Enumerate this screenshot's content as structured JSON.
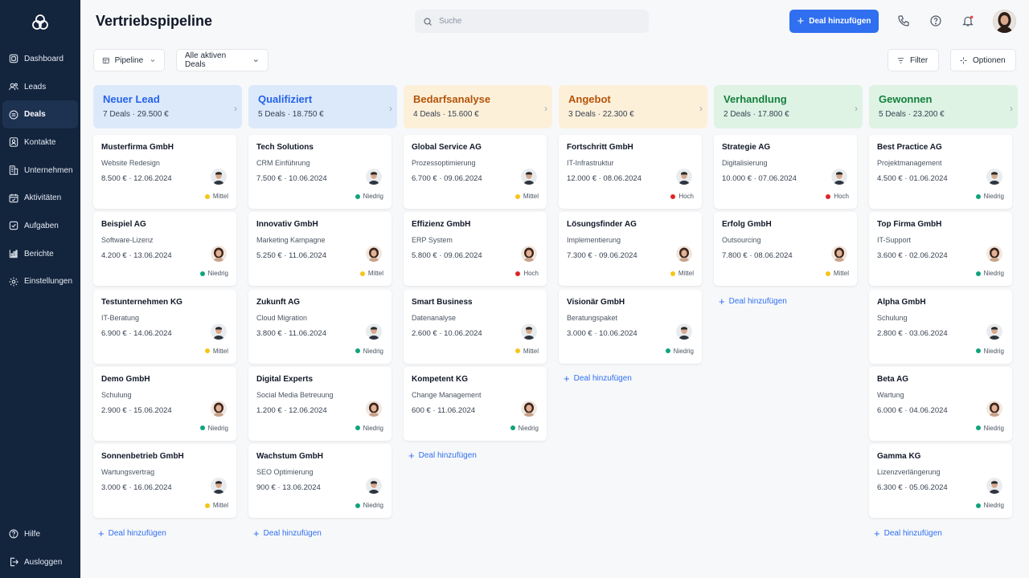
{
  "sidebar": {
    "items": [
      {
        "label": "Dashboard",
        "icon": "dashboard-icon"
      },
      {
        "label": "Leads",
        "icon": "users-icon"
      },
      {
        "label": "Deals",
        "icon": "deals-icon"
      },
      {
        "label": "Kontakte",
        "icon": "contact-icon"
      },
      {
        "label": "Unternehmen",
        "icon": "building-icon"
      },
      {
        "label": "Aktivitäten",
        "icon": "calendar-icon"
      },
      {
        "label": "Aufgaben",
        "icon": "task-icon"
      },
      {
        "label": "Berichte",
        "icon": "chart-icon"
      },
      {
        "label": "Einstellungen",
        "icon": "gear-icon"
      }
    ],
    "bottom": [
      {
        "label": "Hilfe",
        "icon": "help-icon"
      },
      {
        "label": "Ausloggen",
        "icon": "logout-icon"
      }
    ]
  },
  "header": {
    "title": "Vertriebspipeline",
    "search_placeholder": "Suche",
    "add_label": "Deal hinzufügen"
  },
  "toolbar": {
    "view_label": "Pipeline",
    "filter_select": "Alle aktiven Deals",
    "filter_label": "Filter",
    "options_label": "Optionen"
  },
  "add_deal_label": "Deal hinzufügen",
  "colors": {
    "accent": "#2f6ff0",
    "high": "#dc2626",
    "medium": "#f5c518",
    "low": "#10a37f"
  },
  "columns": [
    {
      "title": "Neuer Lead",
      "summary": "7 Deals · 29.500 €",
      "color": "#2563eb",
      "bg": "#dce9fb",
      "cards": [
        {
          "name": "Musterfirma GmbH",
          "product": "Website Redesign",
          "value": "8.500 € · 12.06.2024",
          "priority": "Mittel",
          "p": "m",
          "g": "m"
        },
        {
          "name": "Beispiel AG",
          "product": "Software-Lizenz",
          "value": "4.200 € · 13.06.2024",
          "priority": "Niedrig",
          "p": "l",
          "g": "f"
        },
        {
          "name": "Testunternehmen KG",
          "product": "IT-Beratung",
          "value": "6.900 € · 14.06.2024",
          "priority": "Mittel",
          "p": "m",
          "g": "m"
        },
        {
          "name": "Demo GmbH",
          "product": "Schulung",
          "value": "2.900 € · 15.06.2024",
          "priority": "Niedrig",
          "p": "l",
          "g": "f"
        },
        {
          "name": "Sonnenbetrieb GmbH",
          "product": "Wartungsvertrag",
          "value": "3.000 € · 16.06.2024",
          "priority": "Mittel",
          "p": "m",
          "g": "m"
        }
      ]
    },
    {
      "title": "Qualifiziert",
      "summary": "5 Deals · 18.750 €",
      "color": "#2563eb",
      "bg": "#dce9fb",
      "cards": [
        {
          "name": "Tech Solutions",
          "product": "CRM Einführung",
          "value": "7.500 € · 10.06.2024",
          "priority": "Niedrig",
          "p": "l",
          "g": "m"
        },
        {
          "name": "Innovativ GmbH",
          "product": "Marketing Kampagne",
          "value": "5.250 € · 11.06.2024",
          "priority": "Mittel",
          "p": "m",
          "g": "f"
        },
        {
          "name": "Zukunft AG",
          "product": "Cloud Migration",
          "value": "3.800 € · 11.06.2024",
          "priority": "Niedrig",
          "p": "l",
          "g": "m"
        },
        {
          "name": "Digital Experts",
          "product": "Social Media Betreuung",
          "value": "1.200 € · 12.06.2024",
          "priority": "Niedrig",
          "p": "l",
          "g": "f"
        },
        {
          "name": "Wachstum GmbH",
          "product": "SEO Optimierung",
          "value": "900 € · 13.06.2024",
          "priority": "Niedrig",
          "p": "l",
          "g": "m"
        }
      ]
    },
    {
      "title": "Bedarfsanalyse",
      "summary": "4 Deals · 15.600 €",
      "color": "#b45309",
      "bg": "#fdf0d9",
      "cards": [
        {
          "name": "Global Service AG",
          "product": "Prozessoptimierung",
          "value": "6.700 € · 09.06.2024",
          "priority": "Mittel",
          "p": "m",
          "g": "m"
        },
        {
          "name": "Effizienz GmbH",
          "product": "ERP System",
          "value": "5.800 € · 09.06.2024",
          "priority": "Hoch",
          "p": "h",
          "g": "f"
        },
        {
          "name": "Smart Business",
          "product": "Datenanalyse",
          "value": "2.600 € · 10.06.2024",
          "priority": "Mittel",
          "p": "m",
          "g": "m"
        },
        {
          "name": "Kompetent KG",
          "product": "Change Management",
          "value": "600 € · 11.06.2024",
          "priority": "Niedrig",
          "p": "l",
          "g": "f"
        }
      ]
    },
    {
      "title": "Angebot",
      "summary": "3 Deals · 22.300 €",
      "color": "#b45309",
      "bg": "#fdf0d9",
      "cards": [
        {
          "name": "Fortschritt GmbH",
          "product": "IT-Infrastruktur",
          "value": "12.000 € · 08.06.2024",
          "priority": "Hoch",
          "p": "h",
          "g": "m"
        },
        {
          "name": "Lösungsfinder AG",
          "product": "Implementierung",
          "value": "7.300 € · 09.06.2024",
          "priority": "Mittel",
          "p": "m",
          "g": "f"
        },
        {
          "name": "Visionär GmbH",
          "product": "Beratungspaket",
          "value": "3.000 € · 10.06.2024",
          "priority": "Niedrig",
          "p": "l",
          "g": "m"
        }
      ]
    },
    {
      "title": "Verhandlung",
      "summary": "2 Deals · 17.800 €",
      "color": "#15803d",
      "bg": "#def3e4",
      "cards": [
        {
          "name": "Strategie AG",
          "product": "Digitalisierung",
          "value": "10.000 € · 07.06.2024",
          "priority": "Hoch",
          "p": "h",
          "g": "m"
        },
        {
          "name": "Erfolg GmbH",
          "product": "Outsourcing",
          "value": "7.800 € · 08.06.2024",
          "priority": "Mittel",
          "p": "m",
          "g": "f"
        }
      ]
    },
    {
      "title": "Gewonnen",
      "summary": "5 Deals · 23.200 €",
      "color": "#15803d",
      "bg": "#def3e4",
      "cards": [
        {
          "name": "Best Practice AG",
          "product": "Projektmanagement",
          "value": "4.500 € · 01.06.2024",
          "priority": "Niedrig",
          "p": "l",
          "g": "m"
        },
        {
          "name": "Top Firma GmbH",
          "product": "IT-Support",
          "value": "3.600 € · 02.06.2024",
          "priority": "Niedrig",
          "p": "l",
          "g": "f"
        },
        {
          "name": "Alpha GmbH",
          "product": "Schulung",
          "value": "2.800 € · 03.06.2024",
          "priority": "Niedrig",
          "p": "l",
          "g": "m"
        },
        {
          "name": "Beta AG",
          "product": "Wartung",
          "value": "6.000 € · 04.06.2024",
          "priority": "Niedrig",
          "p": "l",
          "g": "f"
        },
        {
          "name": "Gamma KG",
          "product": "Lizenzverlängerung",
          "value": "6.300 € · 05.06.2024",
          "priority": "Niedrig",
          "p": "l",
          "g": "m"
        }
      ]
    }
  ]
}
